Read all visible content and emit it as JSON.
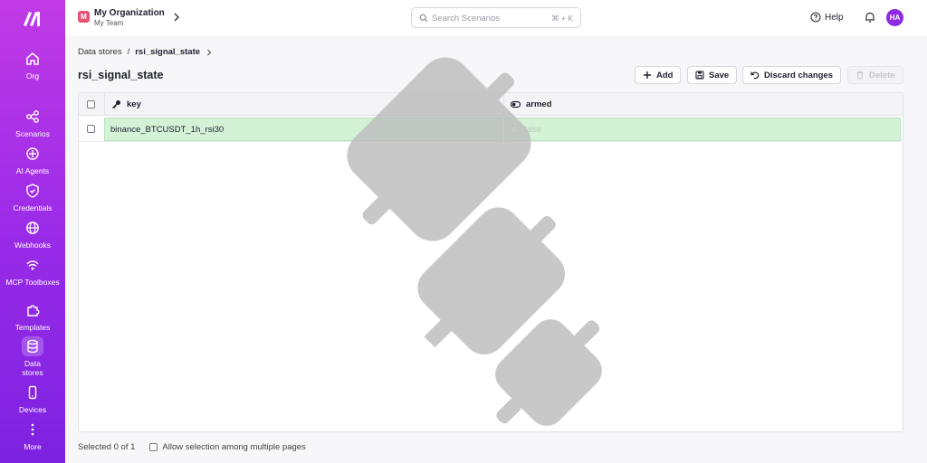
{
  "sidebar": {
    "items": [
      {
        "label": "Org",
        "icon": "home-icon"
      },
      {
        "label": "Scenarios",
        "icon": "scenarios-icon"
      },
      {
        "label": "AI Agents",
        "icon": "ai-agents-icon"
      },
      {
        "label": "Credentials",
        "icon": "shield-icon"
      },
      {
        "label": "Webhooks",
        "icon": "globe-icon"
      },
      {
        "label": "MCP Toolboxes",
        "icon": "mcp-icon"
      },
      {
        "label": "Templates",
        "icon": "puzzle-icon"
      },
      {
        "label": "Data stores",
        "icon": "database-icon",
        "active": true
      },
      {
        "label": "Devices",
        "icon": "phone-icon"
      },
      {
        "label": "More",
        "icon": "more-dots-icon"
      }
    ]
  },
  "header": {
    "org_badge": "M",
    "org_name": "My Organization",
    "team_name": "My Team",
    "search_placeholder": "Search Scenarios",
    "search_shortcut": "⌘ + K",
    "help_label": "Help",
    "avatar_initials": "HA"
  },
  "breadcrumb": {
    "root": "Data stores",
    "separator": "/",
    "current": "rsi_signal_state"
  },
  "page_title": "rsi_signal_state",
  "toolbar": {
    "add_label": "Add",
    "save_label": "Save",
    "discard_label": "Discard changes",
    "delete_label": "Delete"
  },
  "table": {
    "columns": [
      {
        "label": "key",
        "icon": "key-icon"
      },
      {
        "label": "armed",
        "icon": "toggle-icon"
      }
    ],
    "rows": [
      {
        "key": "binance_BTCUSDT_1h_rsi30",
        "armed": "false"
      }
    ]
  },
  "footer": {
    "selected_text": "Selected 0 of 1",
    "allow_multi_label": "Allow selection among multiple pages"
  },
  "colors": {
    "sidebar_top": "#c13ae6",
    "sidebar_bottom": "#7c22e0",
    "row_highlight": "#d3f2d6",
    "avatar": "#8d2ae4",
    "org_badge": "#e25577"
  }
}
